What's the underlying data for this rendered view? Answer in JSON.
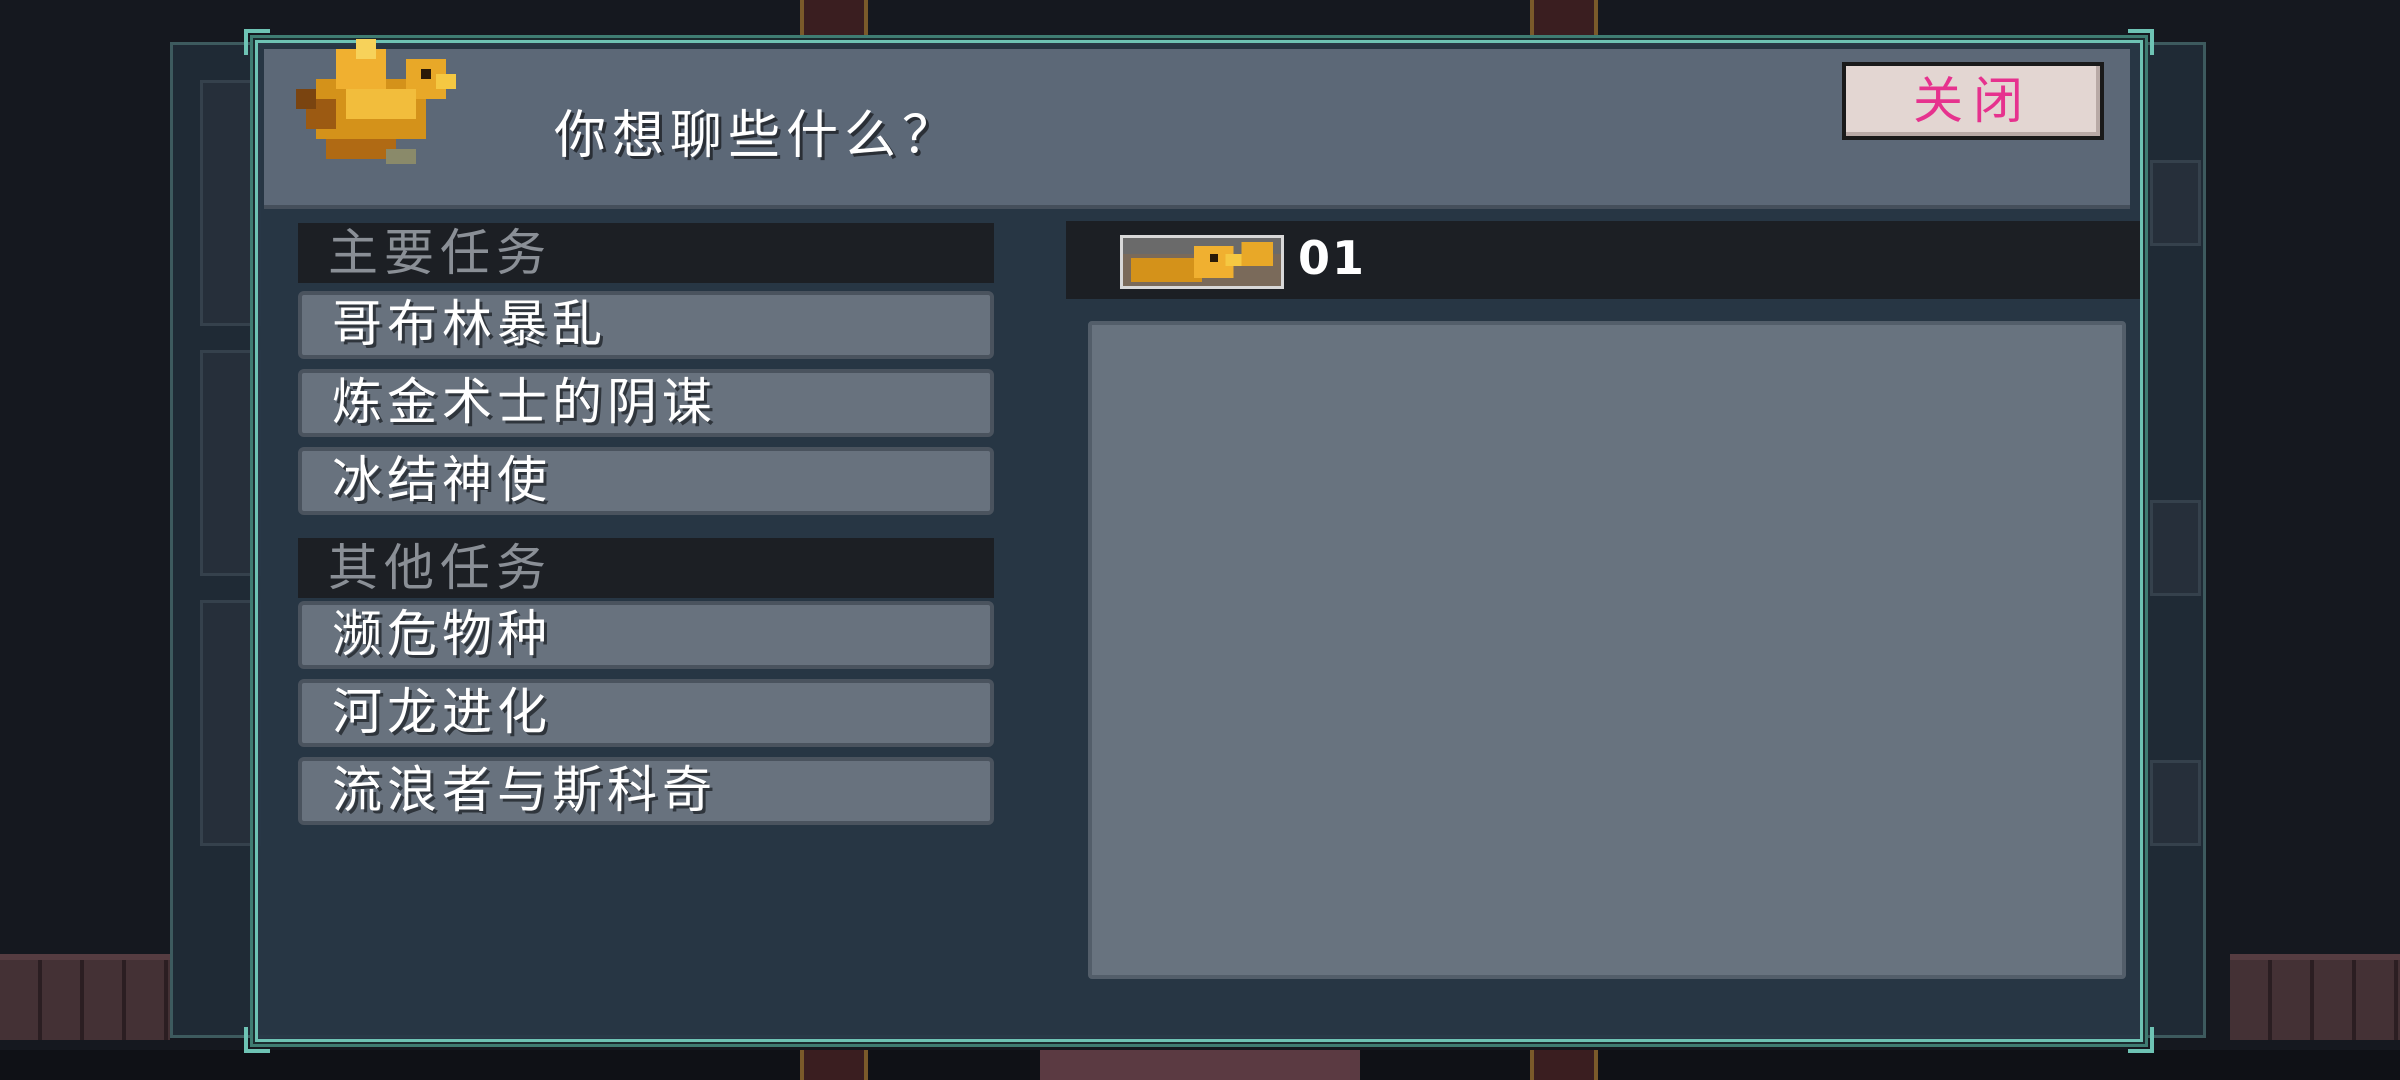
{
  "dialog": {
    "title": "你想聊些什么？",
    "close_label": "关闭",
    "npc_icon": "golden-bird-icon"
  },
  "quests": {
    "main_header": "主要任务",
    "main_items": [
      {
        "label": "哥布林暴乱"
      },
      {
        "label": "炼金术士的阴谋"
      },
      {
        "label": "冰结神使"
      }
    ],
    "other_header": "其他任务",
    "other_items": [
      {
        "label": "濒危物种"
      },
      {
        "label": "河龙进化"
      },
      {
        "label": "流浪者与斯科奇"
      }
    ]
  },
  "detail": {
    "portrait_icon": "bird-portrait-icon",
    "count": "01"
  },
  "colors": {
    "frame_accent": "#6ec3b4",
    "close_text": "#e6328e",
    "close_bg": "#e3d6d2"
  }
}
